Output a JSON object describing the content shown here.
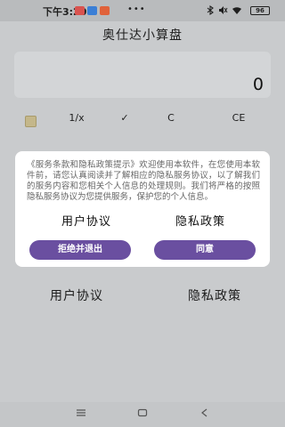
{
  "status_bar": {
    "time": "下午3:20",
    "dots": "•••",
    "battery": "96"
  },
  "app": {
    "title": "奥仕达小算盘",
    "display_value": "0",
    "keys": [
      "1/x",
      "✓",
      "C",
      "CE"
    ],
    "bottom_links": {
      "user_agreement": "用户协议",
      "privacy_policy": "隐私政策"
    }
  },
  "dialog": {
    "body": "《服务条款和隐私政策提示》欢迎使用本软件，在您使用本软件前，请您认真阅读并了解相应的隐私服务协议，以了解我们的服务内容和您相关个人信息的处理规则。我们将严格的按照隐私服务协议为您提供服务，保护您的个人信息。",
    "user_agreement": "用户协议",
    "privacy_policy": "隐私政策",
    "reject_button": "拒绝并退出",
    "agree_button": "同意"
  },
  "nav_bar": {
    "menu_icon": "menu-icon",
    "home_icon": "home-icon",
    "back_icon": "back-icon"
  },
  "colors": {
    "accent": "#6a4fa0",
    "overlay": "#c9cbcd"
  }
}
